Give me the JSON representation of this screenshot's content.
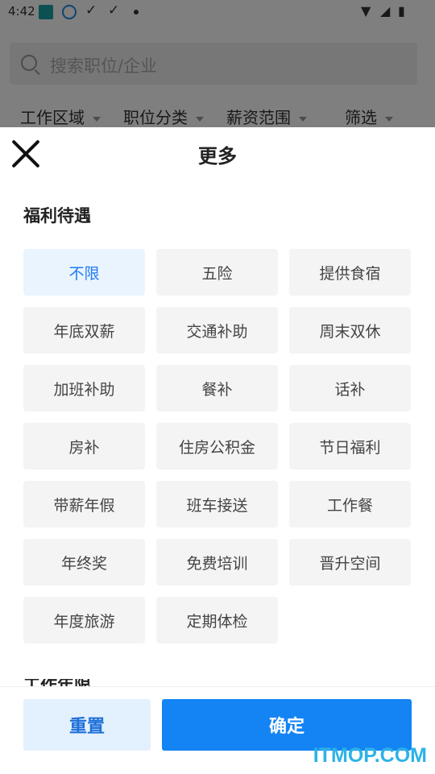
{
  "status_bar": {
    "time": "4:42"
  },
  "search": {
    "placeholder": "搜索职位/企业"
  },
  "filters": [
    "工作区域",
    "职位分类",
    "薪资范围",
    "筛选"
  ],
  "sheet": {
    "title": "更多",
    "section_title": "福利待遇",
    "chips": [
      {
        "label": "不限",
        "selected": true
      },
      {
        "label": "五险",
        "selected": false
      },
      {
        "label": "提供食宿",
        "selected": false
      },
      {
        "label": "年底双薪",
        "selected": false
      },
      {
        "label": "交通补助",
        "selected": false
      },
      {
        "label": "周末双休",
        "selected": false
      },
      {
        "label": "加班补助",
        "selected": false
      },
      {
        "label": "餐补",
        "selected": false
      },
      {
        "label": "话补",
        "selected": false
      },
      {
        "label": "房补",
        "selected": false
      },
      {
        "label": "住房公积金",
        "selected": false
      },
      {
        "label": "节日福利",
        "selected": false
      },
      {
        "label": "带薪年假",
        "selected": false
      },
      {
        "label": "班车接送",
        "selected": false
      },
      {
        "label": "工作餐",
        "selected": false
      },
      {
        "label": "年终奖",
        "selected": false
      },
      {
        "label": "免费培训",
        "selected": false
      },
      {
        "label": "晋升空间",
        "selected": false
      },
      {
        "label": "年度旅游",
        "selected": false
      },
      {
        "label": "定期体检",
        "selected": false
      }
    ],
    "next_section_title": "工作年限",
    "reset_label": "重置",
    "confirm_label": "确定"
  },
  "watermark": "ITMOP.COM",
  "colors": {
    "accent": "#1484f4",
    "selected_bg": "#eaf4ff",
    "reset_bg": "#e3f0fd"
  }
}
